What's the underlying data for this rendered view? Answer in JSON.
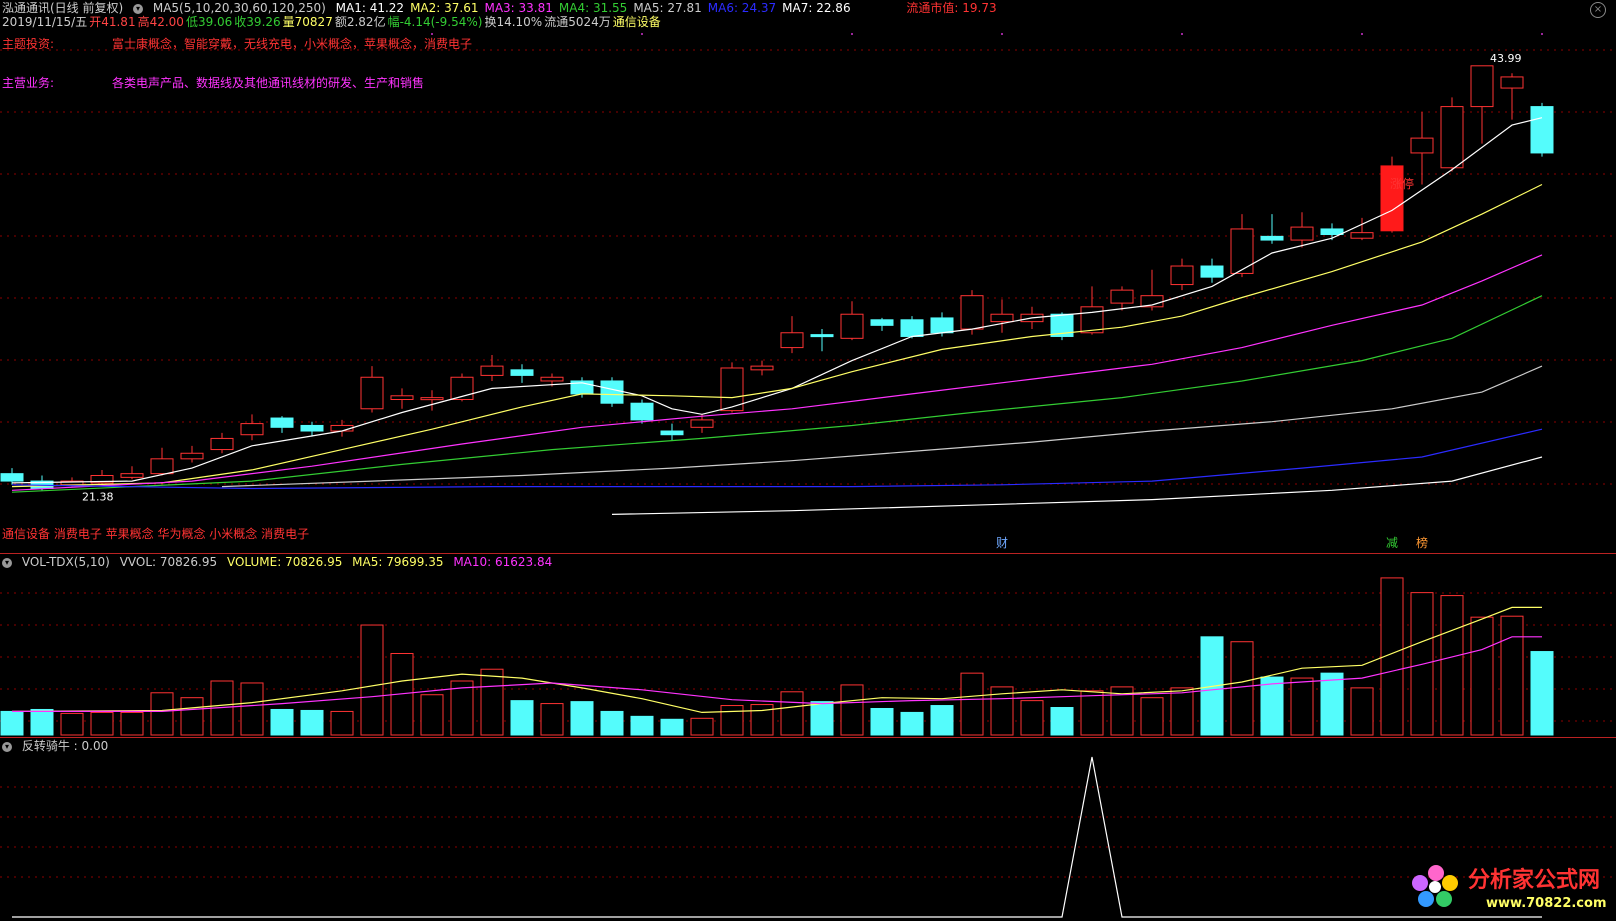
{
  "header": {
    "stock_name": "泓通通讯(日线 前复权)",
    "ma_params": "MA5(5,10,20,30,60,120,250)",
    "ma": [
      {
        "label": "MA1: 41.22",
        "color": "#ffffff"
      },
      {
        "label": "MA2: 37.61",
        "color": "#ffff66"
      },
      {
        "label": "MA3: 33.81",
        "color": "#ff33ff"
      },
      {
        "label": "MA4: 31.55",
        "color": "#33cc33"
      },
      {
        "label": "MA5: 27.81",
        "color": "#cccccc"
      },
      {
        "label": "MA6: 24.37",
        "color": "#2b2bff"
      },
      {
        "label": "MA7: 22.86",
        "color": "#ffffff"
      }
    ],
    "market_cap": "流通市值: 19.73",
    "line2": [
      {
        "label": "2019/11/15/五",
        "color": "#cccccc"
      },
      {
        "label": "开41.81",
        "color": "#ff4444"
      },
      {
        "label": "高42.00",
        "color": "#ff4444"
      },
      {
        "label": "低39.06",
        "color": "#33cc33"
      },
      {
        "label": "收39.26",
        "color": "#33cc33"
      },
      {
        "label": "量70827",
        "color": "#ffff66"
      },
      {
        "label": "额2.82亿",
        "color": "#cccccc"
      },
      {
        "label": "幅-4.14(-9.54%)",
        "color": "#33cc33"
      },
      {
        "label": "换14.10%",
        "color": "#cccccc"
      },
      {
        "label": "流通5024万",
        "color": "#cccccc"
      },
      {
        "label": "通信设备",
        "color": "#ffff66"
      }
    ],
    "theme_label": "主题投资:",
    "theme_text": "富士康概念，智能穿戴，无线充电，小米概念，苹果概念，消费电子",
    "business_label": "主营业务:",
    "business_text": "各类电声产品、数据线及其他通讯线材的研发、生产和销售",
    "concept_tags": "通信设备 消费电子 苹果概念 华为概念 小米概念 消费电子",
    "low_label": "21.38",
    "high_label": "43.99",
    "limit_up_label": "涨停",
    "finance_marker": "财",
    "reduce_marker": "减",
    "list_marker": "榜"
  },
  "volume_header": {
    "title": "VOL-TDX(5,10)",
    "vvol": "VVOL: 70826.95",
    "volume": "VOLUME: 70826.95",
    "ma5": "MA5: 79699.35",
    "ma10": "MA10: 61623.84"
  },
  "indicator_header": {
    "title": "反转骑牛 : 0.00"
  },
  "logo": {
    "text": "分析家公式网",
    "url": "www.70822.com"
  },
  "chart_data": {
    "type": "candlestick",
    "price_range": [
      19.5,
      45.5
    ],
    "candles": [
      [
        22.0,
        21.6,
        22.3,
        21.4
      ],
      [
        21.6,
        21.2,
        21.9,
        21.1
      ],
      [
        21.4,
        21.6,
        21.8,
        21.3
      ],
      [
        21.5,
        21.9,
        22.2,
        21.4
      ],
      [
        21.8,
        22.0,
        22.4,
        21.7
      ],
      [
        22.0,
        22.8,
        23.4,
        21.9
      ],
      [
        22.8,
        23.1,
        23.5,
        22.6
      ],
      [
        23.3,
        23.9,
        24.2,
        23.1
      ],
      [
        24.1,
        24.7,
        25.2,
        23.8
      ],
      [
        25.0,
        24.5,
        25.1,
        24.2
      ],
      [
        24.6,
        24.3,
        24.8,
        24.0
      ],
      [
        24.3,
        24.6,
        24.9,
        24.0
      ],
      [
        25.5,
        27.2,
        27.8,
        25.3
      ],
      [
        26.0,
        26.2,
        26.6,
        25.5
      ],
      [
        26.0,
        26.1,
        26.5,
        25.4
      ],
      [
        26.0,
        27.2,
        27.4,
        25.9
      ],
      [
        27.3,
        27.8,
        28.4,
        27.0
      ],
      [
        27.6,
        27.3,
        27.9,
        26.9
      ],
      [
        27.0,
        27.2,
        27.4,
        26.7
      ],
      [
        27.0,
        26.3,
        27.2,
        26.1
      ],
      [
        27.0,
        25.8,
        27.2,
        25.6
      ],
      [
        25.8,
        24.9,
        26.0,
        24.7
      ],
      [
        24.3,
        24.1,
        24.7,
        23.8
      ],
      [
        24.5,
        24.9,
        25.2,
        24.2
      ],
      [
        25.4,
        27.7,
        28.0,
        25.3
      ],
      [
        27.6,
        27.8,
        28.1,
        27.3
      ],
      [
        28.8,
        29.6,
        30.5,
        28.5
      ],
      [
        29.5,
        29.4,
        29.8,
        28.6
      ],
      [
        29.3,
        30.6,
        31.3,
        29.2
      ],
      [
        30.3,
        30.0,
        30.4,
        29.7
      ],
      [
        30.3,
        29.4,
        30.5,
        29.3
      ],
      [
        30.4,
        29.6,
        30.7,
        29.4
      ],
      [
        29.8,
        31.6,
        31.9,
        29.5
      ],
      [
        30.2,
        30.6,
        31.4,
        29.6
      ],
      [
        30.2,
        30.6,
        31.0,
        29.8
      ],
      [
        30.6,
        29.4,
        30.7,
        29.2
      ],
      [
        29.6,
        31.0,
        32.1,
        29.5
      ],
      [
        31.2,
        31.9,
        32.1,
        30.8
      ],
      [
        31.0,
        31.6,
        33.0,
        30.8
      ],
      [
        32.2,
        33.2,
        33.6,
        31.9
      ],
      [
        33.2,
        32.6,
        33.6,
        32.3
      ],
      [
        32.8,
        35.2,
        36.0,
        32.6
      ],
      [
        34.8,
        34.6,
        36.0,
        34.4
      ],
      [
        34.6,
        35.3,
        36.1,
        34.2
      ],
      [
        35.2,
        34.9,
        35.5,
        34.6
      ],
      [
        34.7,
        35.0,
        35.8,
        34.6
      ],
      [
        35.1,
        38.6,
        39.1,
        35.0
      ],
      [
        39.3,
        40.1,
        41.5,
        37.6
      ],
      [
        38.5,
        41.8,
        42.3,
        38.3
      ],
      [
        41.8,
        44.0,
        44.0,
        39.8
      ],
      [
        42.8,
        43.4,
        43.6,
        41.1
      ],
      [
        41.8,
        39.3,
        42.0,
        39.1
      ]
    ],
    "ma_series": [
      {
        "name": "MA1",
        "color": "#ffffff",
        "values": [
          [
            0,
            21.5
          ],
          [
            4,
            21.6
          ],
          [
            6,
            22.3
          ],
          [
            8,
            23.5
          ],
          [
            11,
            24.3
          ],
          [
            13,
            25.3
          ],
          [
            16,
            26.6
          ],
          [
            19,
            26.9
          ],
          [
            21,
            26.2
          ],
          [
            22,
            25.5
          ],
          [
            23,
            25.2
          ],
          [
            24,
            25.6
          ],
          [
            26,
            26.6
          ],
          [
            28,
            28.1
          ],
          [
            30,
            29.4
          ],
          [
            32,
            29.8
          ],
          [
            34,
            30.4
          ],
          [
            36,
            30.7
          ],
          [
            38,
            31.1
          ],
          [
            40,
            32.1
          ],
          [
            42,
            33.9
          ],
          [
            44,
            34.7
          ],
          [
            46,
            36.2
          ],
          [
            48,
            38.4
          ],
          [
            50,
            40.8
          ],
          [
            51,
            41.2
          ]
        ]
      },
      {
        "name": "MA2",
        "color": "#ffff66",
        "values": [
          [
            0,
            21.3
          ],
          [
            5,
            21.5
          ],
          [
            8,
            22.2
          ],
          [
            11,
            23.3
          ],
          [
            14,
            24.4
          ],
          [
            17,
            25.6
          ],
          [
            19,
            26.3
          ],
          [
            22,
            26.2
          ],
          [
            24,
            26.1
          ],
          [
            26,
            26.6
          ],
          [
            28,
            27.5
          ],
          [
            31,
            28.7
          ],
          [
            34,
            29.4
          ],
          [
            37,
            29.9
          ],
          [
            39,
            30.5
          ],
          [
            41,
            31.5
          ],
          [
            44,
            32.9
          ],
          [
            47,
            34.5
          ],
          [
            49,
            36.0
          ],
          [
            51,
            37.6
          ]
        ]
      },
      {
        "name": "MA3",
        "color": "#ff33ff",
        "values": [
          [
            0,
            21.1
          ],
          [
            6,
            21.6
          ],
          [
            10,
            22.4
          ],
          [
            15,
            23.6
          ],
          [
            19,
            24.5
          ],
          [
            23,
            25.1
          ],
          [
            26,
            25.5
          ],
          [
            30,
            26.3
          ],
          [
            34,
            27.1
          ],
          [
            38,
            27.9
          ],
          [
            41,
            28.8
          ],
          [
            44,
            30.0
          ],
          [
            47,
            31.1
          ],
          [
            49,
            32.4
          ],
          [
            51,
            33.8
          ]
        ]
      },
      {
        "name": "MA4",
        "color": "#33cc33",
        "values": [
          [
            0,
            21.0
          ],
          [
            8,
            21.6
          ],
          [
            13,
            22.5
          ],
          [
            18,
            23.3
          ],
          [
            23,
            23.9
          ],
          [
            28,
            24.6
          ],
          [
            32,
            25.3
          ],
          [
            37,
            26.1
          ],
          [
            41,
            27.0
          ],
          [
            45,
            28.1
          ],
          [
            48,
            29.3
          ],
          [
            51,
            31.6
          ]
        ]
      },
      {
        "name": "MA5",
        "color": "#cccccc",
        "values": [
          [
            7,
            21.3
          ],
          [
            12,
            21.6
          ],
          [
            17,
            21.9
          ],
          [
            22,
            22.3
          ],
          [
            26,
            22.7
          ],
          [
            30,
            23.2
          ],
          [
            34,
            23.7
          ],
          [
            38,
            24.3
          ],
          [
            42,
            24.8
          ],
          [
            46,
            25.5
          ],
          [
            49,
            26.4
          ],
          [
            51,
            27.8
          ]
        ]
      },
      {
        "name": "MA6",
        "color": "#2b2bff",
        "values": [
          [
            0,
            21.4
          ],
          [
            8,
            21.2
          ],
          [
            16,
            21.3
          ],
          [
            22,
            21.3
          ],
          [
            28,
            21.3
          ],
          [
            33,
            21.4
          ],
          [
            38,
            21.6
          ],
          [
            43,
            22.3
          ],
          [
            47,
            22.9
          ],
          [
            51,
            24.4
          ]
        ]
      },
      {
        "name": "MA7",
        "color": "#ffffff",
        "values": [
          [
            20,
            19.8
          ],
          [
            26,
            20.0
          ],
          [
            32,
            20.3
          ],
          [
            38,
            20.6
          ],
          [
            44,
            21.1
          ],
          [
            48,
            21.6
          ],
          [
            51,
            22.9
          ]
        ]
      }
    ],
    "volume_range": [
      0,
      165000
    ],
    "volumes": [
      24000,
      26000,
      22000,
      23000,
      23000,
      43000,
      38000,
      55000,
      53000,
      26000,
      25000,
      24000,
      112000,
      83000,
      41000,
      55000,
      67000,
      35000,
      32000,
      34000,
      24000,
      19000,
      16000,
      17000,
      30000,
      31000,
      44000,
      34000,
      51000,
      27000,
      23000,
      30000,
      63000,
      49000,
      35000,
      28000,
      45000,
      49000,
      38000,
      48000,
      100000,
      95000,
      59000,
      58000,
      63000,
      48000,
      160000,
      145000,
      142000,
      120000,
      121000,
      85000
    ],
    "volume_ma5": [
      [
        0,
        24000
      ],
      [
        5,
        25000
      ],
      [
        8,
        33000
      ],
      [
        11,
        45000
      ],
      [
        13,
        55000
      ],
      [
        15,
        62000
      ],
      [
        17,
        58000
      ],
      [
        19,
        48000
      ],
      [
        21,
        37000
      ],
      [
        23,
        23000
      ],
      [
        25,
        25000
      ],
      [
        27,
        32000
      ],
      [
        29,
        38000
      ],
      [
        31,
        37000
      ],
      [
        33,
        42000
      ],
      [
        35,
        46000
      ],
      [
        37,
        42000
      ],
      [
        39,
        45000
      ],
      [
        41,
        54000
      ],
      [
        43,
        68000
      ],
      [
        45,
        71000
      ],
      [
        47,
        95000
      ],
      [
        49,
        118000
      ],
      [
        50,
        130000
      ],
      [
        51,
        130000
      ]
    ],
    "volume_ma10": [
      [
        0,
        24000
      ],
      [
        5,
        24000
      ],
      [
        9,
        32000
      ],
      [
        12,
        39000
      ],
      [
        15,
        48000
      ],
      [
        18,
        53000
      ],
      [
        21,
        46000
      ],
      [
        24,
        36000
      ],
      [
        27,
        32000
      ],
      [
        30,
        35000
      ],
      [
        33,
        37000
      ],
      [
        36,
        40000
      ],
      [
        39,
        43000
      ],
      [
        42,
        52000
      ],
      [
        45,
        58000
      ],
      [
        47,
        72000
      ],
      [
        49,
        87000
      ],
      [
        50,
        100000
      ],
      [
        51,
        100000
      ]
    ],
    "indicator_range": [
      0,
      1
    ],
    "indicator_values": [
      0,
      0,
      0,
      0,
      0,
      0,
      0,
      0,
      0,
      0,
      0,
      0,
      0,
      0,
      0,
      0,
      0,
      0,
      0,
      0,
      0,
      0,
      0,
      0,
      0,
      0,
      0,
      0,
      0,
      0,
      0,
      0,
      0,
      0,
      0,
      0,
      1,
      0,
      0,
      0,
      0,
      0,
      0,
      0,
      0,
      0,
      0,
      0,
      0,
      0,
      0,
      0
    ]
  }
}
